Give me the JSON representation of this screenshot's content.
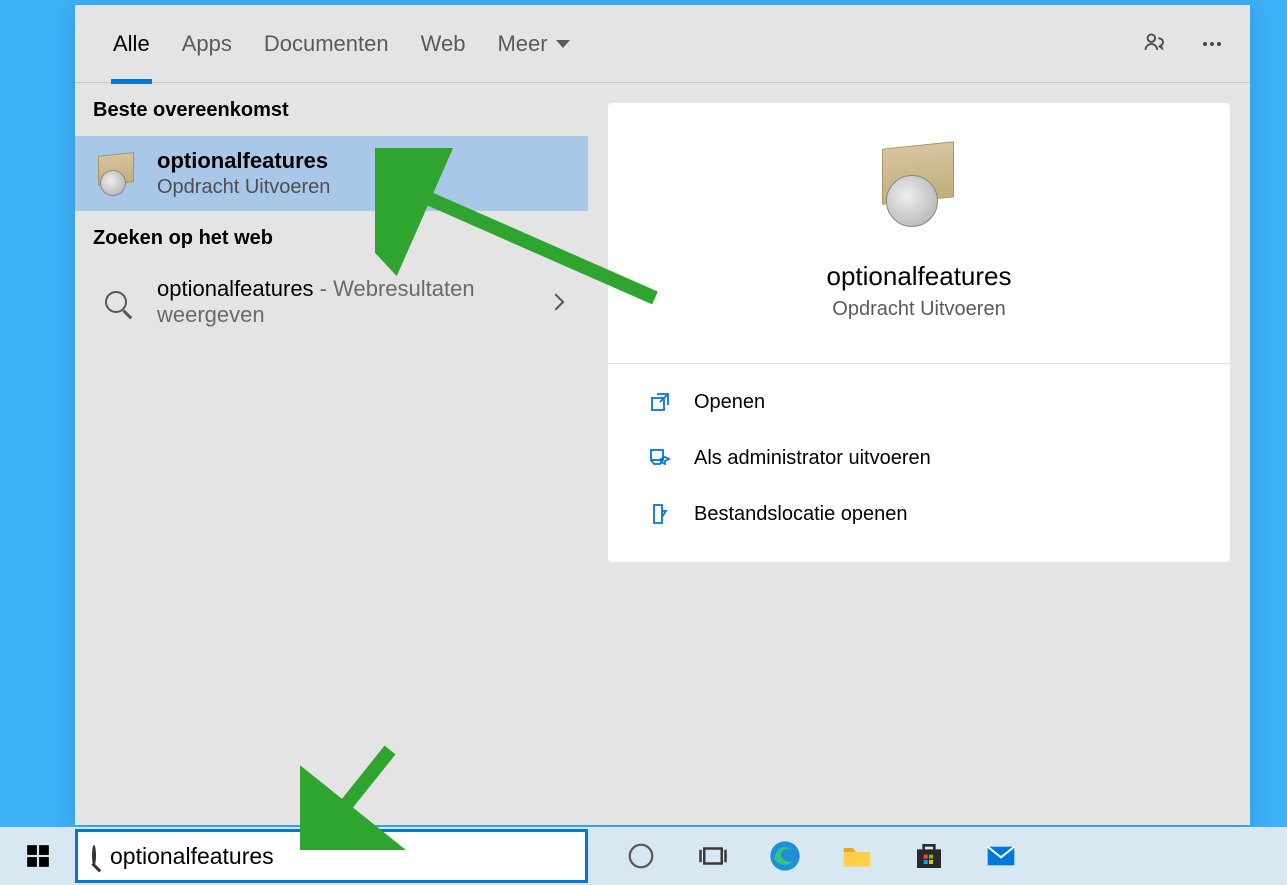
{
  "tabs": {
    "alle": "Alle",
    "apps": "Apps",
    "documenten": "Documenten",
    "web": "Web",
    "meer": "Meer"
  },
  "left": {
    "best_match_header": "Beste overeenkomst",
    "best_match": {
      "title": "optionalfeatures",
      "subtitle": "Opdracht Uitvoeren"
    },
    "web_header": "Zoeken op het web",
    "web_result": {
      "title_main": "optionalfeatures",
      "title_secondary": " - Webresultaten weergeven"
    }
  },
  "detail": {
    "title": "optionalfeatures",
    "subtitle": "Opdracht Uitvoeren",
    "actions": {
      "open": "Openen",
      "admin": "Als administrator uitvoeren",
      "location": "Bestandslocatie openen"
    }
  },
  "search": {
    "value": "optionalfeatures"
  }
}
